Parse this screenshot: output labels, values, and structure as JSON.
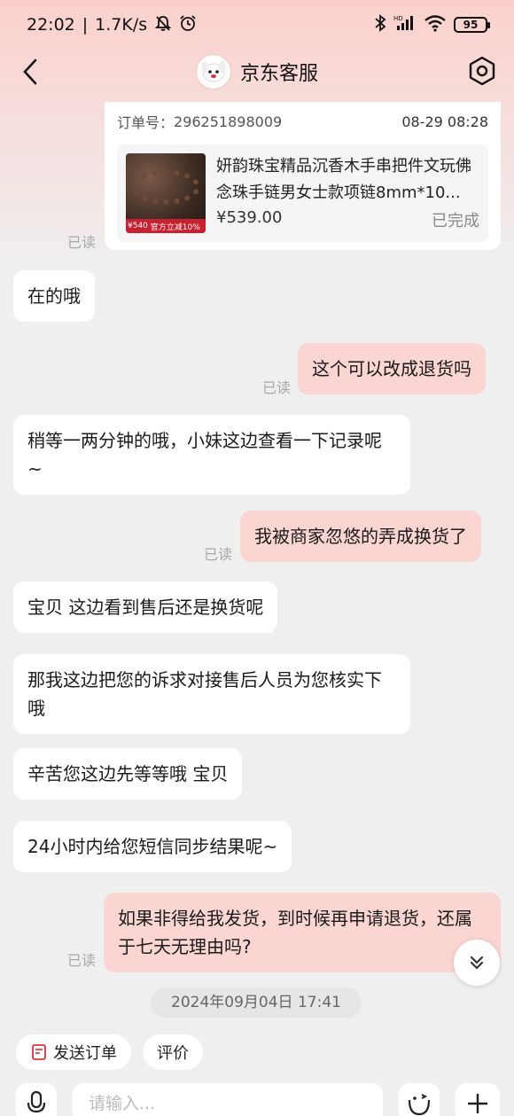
{
  "status_bar": {
    "time": "22:02",
    "separator": "|",
    "network_speed": "1.7K/s",
    "battery": "95",
    "hd_label": "HD"
  },
  "header": {
    "title": "京东客服"
  },
  "order_card": {
    "order_label": "订单号：",
    "order_number": "296251898009",
    "order_time": "08-29 08:28",
    "product_title": "妍韵珠宝精品沉香木手串把件文玩佛念珠手链男女士款项链8mm*10...",
    "product_price": "¥539.00",
    "product_status": "已完成",
    "image_price_tag": "¥540",
    "image_promo": "官方立减10%"
  },
  "read_label": "已读",
  "messages": [
    {
      "side": "left",
      "text": "在的哦"
    },
    {
      "side": "right",
      "text": "这个可以改成退货吗"
    },
    {
      "side": "left",
      "text": "稍等一两分钟的哦，小妹这边查看一下记录呢~"
    },
    {
      "side": "right",
      "text": "我被商家忽悠的弄成换货了"
    },
    {
      "side": "left",
      "text": "宝贝  这边看到售后还是换货呢"
    },
    {
      "side": "left",
      "text": "那我这边把您的诉求对接售后人员为您核实下哦"
    },
    {
      "side": "left",
      "text": "辛苦您这边先等等哦  宝贝"
    },
    {
      "side": "left",
      "text": "24小时内给您短信同步结果呢~"
    },
    {
      "side": "right",
      "text": "如果非得给我发货，到时候再申请退货，还属于七天无理由吗?"
    }
  ],
  "timestamp": "2024年09月04日  17:41",
  "quick_actions": {
    "send_order": "发送订单",
    "rate": "评价"
  },
  "input": {
    "placeholder": "请输入..."
  },
  "colors": {
    "accent": "#fbd5d1",
    "header_gradient": "#fbd0cc",
    "background": "#efefef"
  }
}
